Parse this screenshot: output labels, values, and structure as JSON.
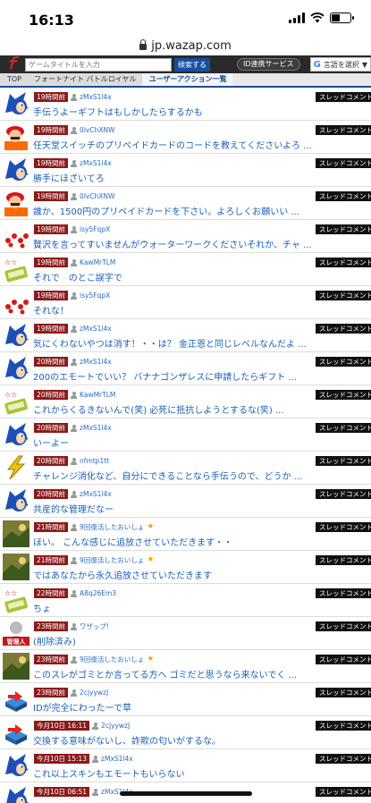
{
  "status": {
    "time": "16:13"
  },
  "browser": {
    "url": "jp.wazap.com"
  },
  "header": {
    "search_placeholder": "ゲームタイトルを入力",
    "search_button": "検索する",
    "id_service": "ID連携サービス",
    "lang_label": "言語を選択"
  },
  "breadcrumb": [
    "TOP",
    "フォートナイト バトルロイヤル",
    "ユーザーアクション一覧"
  ],
  "colors": {
    "accent": "#1b4d9b",
    "time_badge": "#8b1a1a",
    "link": "#1a5fb4"
  },
  "rows": [
    {
      "avatar": "blue-hedgehog-icon",
      "time": "19時間前",
      "user": "zMxS1l4x",
      "tag": "スレッドコメント",
      "comment": "手伝うよーギフトはもしかしたらするかも"
    },
    {
      "avatar": "red-plumber-icon",
      "time": "19時間前",
      "user": "0lvChXNW",
      "tag": "スレッドコメント",
      "comment": "任天堂スイッチのプリペイドカードのコードを教えてくださいよろ ..."
    },
    {
      "avatar": "blue-hedgehog-icon",
      "time": "19時間前",
      "user": "zMxS1l4x",
      "tag": "スレッドコメント",
      "comment": "勝手にほざいてろ"
    },
    {
      "avatar": "red-plumber-icon",
      "time": "19時間前",
      "user": "0lvChXNW",
      "tag": "スレッドコメント",
      "comment": "誰か、1500円のプリペイドカードを下さい。よろしくお願いい ..."
    },
    {
      "avatar": "red-dots-icon",
      "time": "19時間前",
      "user": "isy5FqpX",
      "tag": "スレッドコメント",
      "comment": "贅沢を言ってすいませんがウォーターワークくださいそれか、チャ ..."
    },
    {
      "avatar": "rank-card-icon",
      "time": "19時間前",
      "user": "KawMrTLM",
      "tag": "スレッドコメント",
      "comment": "それで　のとこ誤字で"
    },
    {
      "avatar": "red-dots-icon",
      "time": "19時間前",
      "user": "isy5FqpX",
      "tag": "スレッドコメント",
      "comment": "それな！"
    },
    {
      "avatar": "blue-hedgehog-icon",
      "time": "19時間前",
      "user": "zMxS1l4x",
      "tag": "スレッドコメント",
      "comment": "気にくわないやつは消す！・・は？ 金正恩と同じレベルなんだよ ..."
    },
    {
      "avatar": "blue-hedgehog-icon",
      "time": "20時間前",
      "user": "zMxS1l4x",
      "tag": "スレッドコメント",
      "comment": "200のエモートでいい？ バナナゴンザレスに申請したらギフト ..."
    },
    {
      "avatar": "rank-card-icon",
      "time": "20時間前",
      "user": "KawMrTLM",
      "tag": "スレッドコメント",
      "comment": "これからくるきないんで(笑) 必死に抵抗しようとするな(笑) ..."
    },
    {
      "avatar": "blue-hedgehog-icon",
      "time": "20時間前",
      "user": "zMxS1l4x",
      "tag": "スレッドコメント",
      "comment": "いーよー"
    },
    {
      "avatar": "lightning-icon",
      "time": "20時間前",
      "user": "nfmtp1tt",
      "tag": "スレッドコメント",
      "comment": "チャレンジ消化など、自分にできることなら手伝うので、どうか ..."
    },
    {
      "avatar": "blue-hedgehog-icon",
      "time": "20時間前",
      "user": "zMxS1l4x",
      "tag": "スレッドコメント",
      "comment": "共産的な管理だなー"
    },
    {
      "avatar": "landscape-icon",
      "time": "21時間前",
      "user": "9回復活したおいしょ",
      "star": true,
      "tag": "スレッドコメント",
      "comment": "ほい。 こんな感じに追放させていただきます・・"
    },
    {
      "avatar": "landscape-icon",
      "time": "21時間前",
      "user": "9回復活したおいしょ",
      "star": true,
      "tag": "スレッドコメント",
      "comment": "ではあなたから永久追放させていただきます"
    },
    {
      "avatar": "rank-card-icon",
      "time": "22時間前",
      "user": "A8q26Em3",
      "tag": "スレッドコメント",
      "comment": "ちょ"
    },
    {
      "avatar": "admin-icon",
      "avatar_label": "管理人",
      "time": "23時間前",
      "user": "ワザップ!",
      "tag": "スレッドコメント",
      "comment": "(削除済み)"
    },
    {
      "avatar": "landscape-icon",
      "time": "23時間前",
      "user": "9回復活したおいしょ",
      "star": true,
      "tag": "スレッドコメント",
      "comment": "このスレがゴミとか言ってる方へ ゴミだと思うなら来ないでく ..."
    },
    {
      "avatar": "cube-arrow-icon",
      "time": "23時間前",
      "user": "2cjyywzJ",
      "tag": "スレッドコメント",
      "comment": "IDが完全にわったーで草"
    },
    {
      "avatar": "cube-arrow-icon",
      "time": "今月10日 16:11",
      "user": "2cjyywzJ",
      "tag": "スレッドコメント",
      "comment": "交換する意味がないし、詐欺の匂いがするな。"
    },
    {
      "avatar": "blue-hedgehog-icon",
      "time": "今月10日 15:13",
      "user": "zMxS1l4x",
      "tag": "スレッドコメント",
      "comment": "これ以上スキンもエモートもいらない"
    },
    {
      "avatar": "blue-hedgehog-icon",
      "time": "今月10日 06:51",
      "user": "zMxS1l4x",
      "tag": "スレッドコメント",
      "comment": ""
    }
  ]
}
